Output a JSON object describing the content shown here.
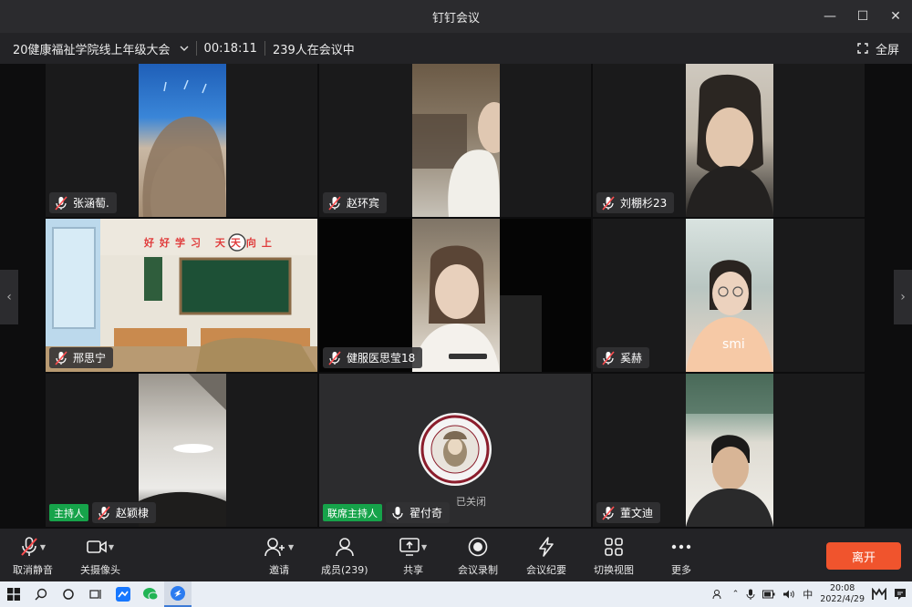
{
  "window": {
    "title": "钉钉会议"
  },
  "meeting": {
    "name": "20健康福祉学院线上年级大会",
    "duration": "00:18:11",
    "attendees": "239人在会议中",
    "fullscreen_label": "全屏"
  },
  "participants": [
    {
      "name": "张涵萄.",
      "mic": "muted"
    },
    {
      "name": "赵环宾",
      "mic": "muted"
    },
    {
      "name": "刘棚杉23",
      "mic": "muted"
    },
    {
      "name": "邢思宁",
      "mic": "muted"
    },
    {
      "name": "健服医思莹18",
      "mic": "muted"
    },
    {
      "name": "奚赫",
      "mic": "muted"
    },
    {
      "name": "赵颖棣",
      "mic": "muted",
      "badge": "主持人"
    },
    {
      "name": "翟付奇",
      "mic": "on",
      "badge": "联席主持人",
      "camera_status": "已关闭"
    },
    {
      "name": "董文迪",
      "mic": "muted"
    }
  ],
  "classroom_banner": "好好学习  天天向上",
  "toolbar": {
    "unmute": "取消静音",
    "camera_off": "关摄像头",
    "invite": "邀请",
    "members": "成员(239)",
    "share": "共享",
    "record": "会议录制",
    "minutes": "会议纪要",
    "switch_view": "切换视图",
    "more": "更多",
    "leave": "离开"
  },
  "taskbar": {
    "ime": "中",
    "time": "20:08",
    "date": "2022/4/29"
  },
  "colors": {
    "accent_leave": "#f0542d",
    "host_badge": "#16a34a"
  }
}
